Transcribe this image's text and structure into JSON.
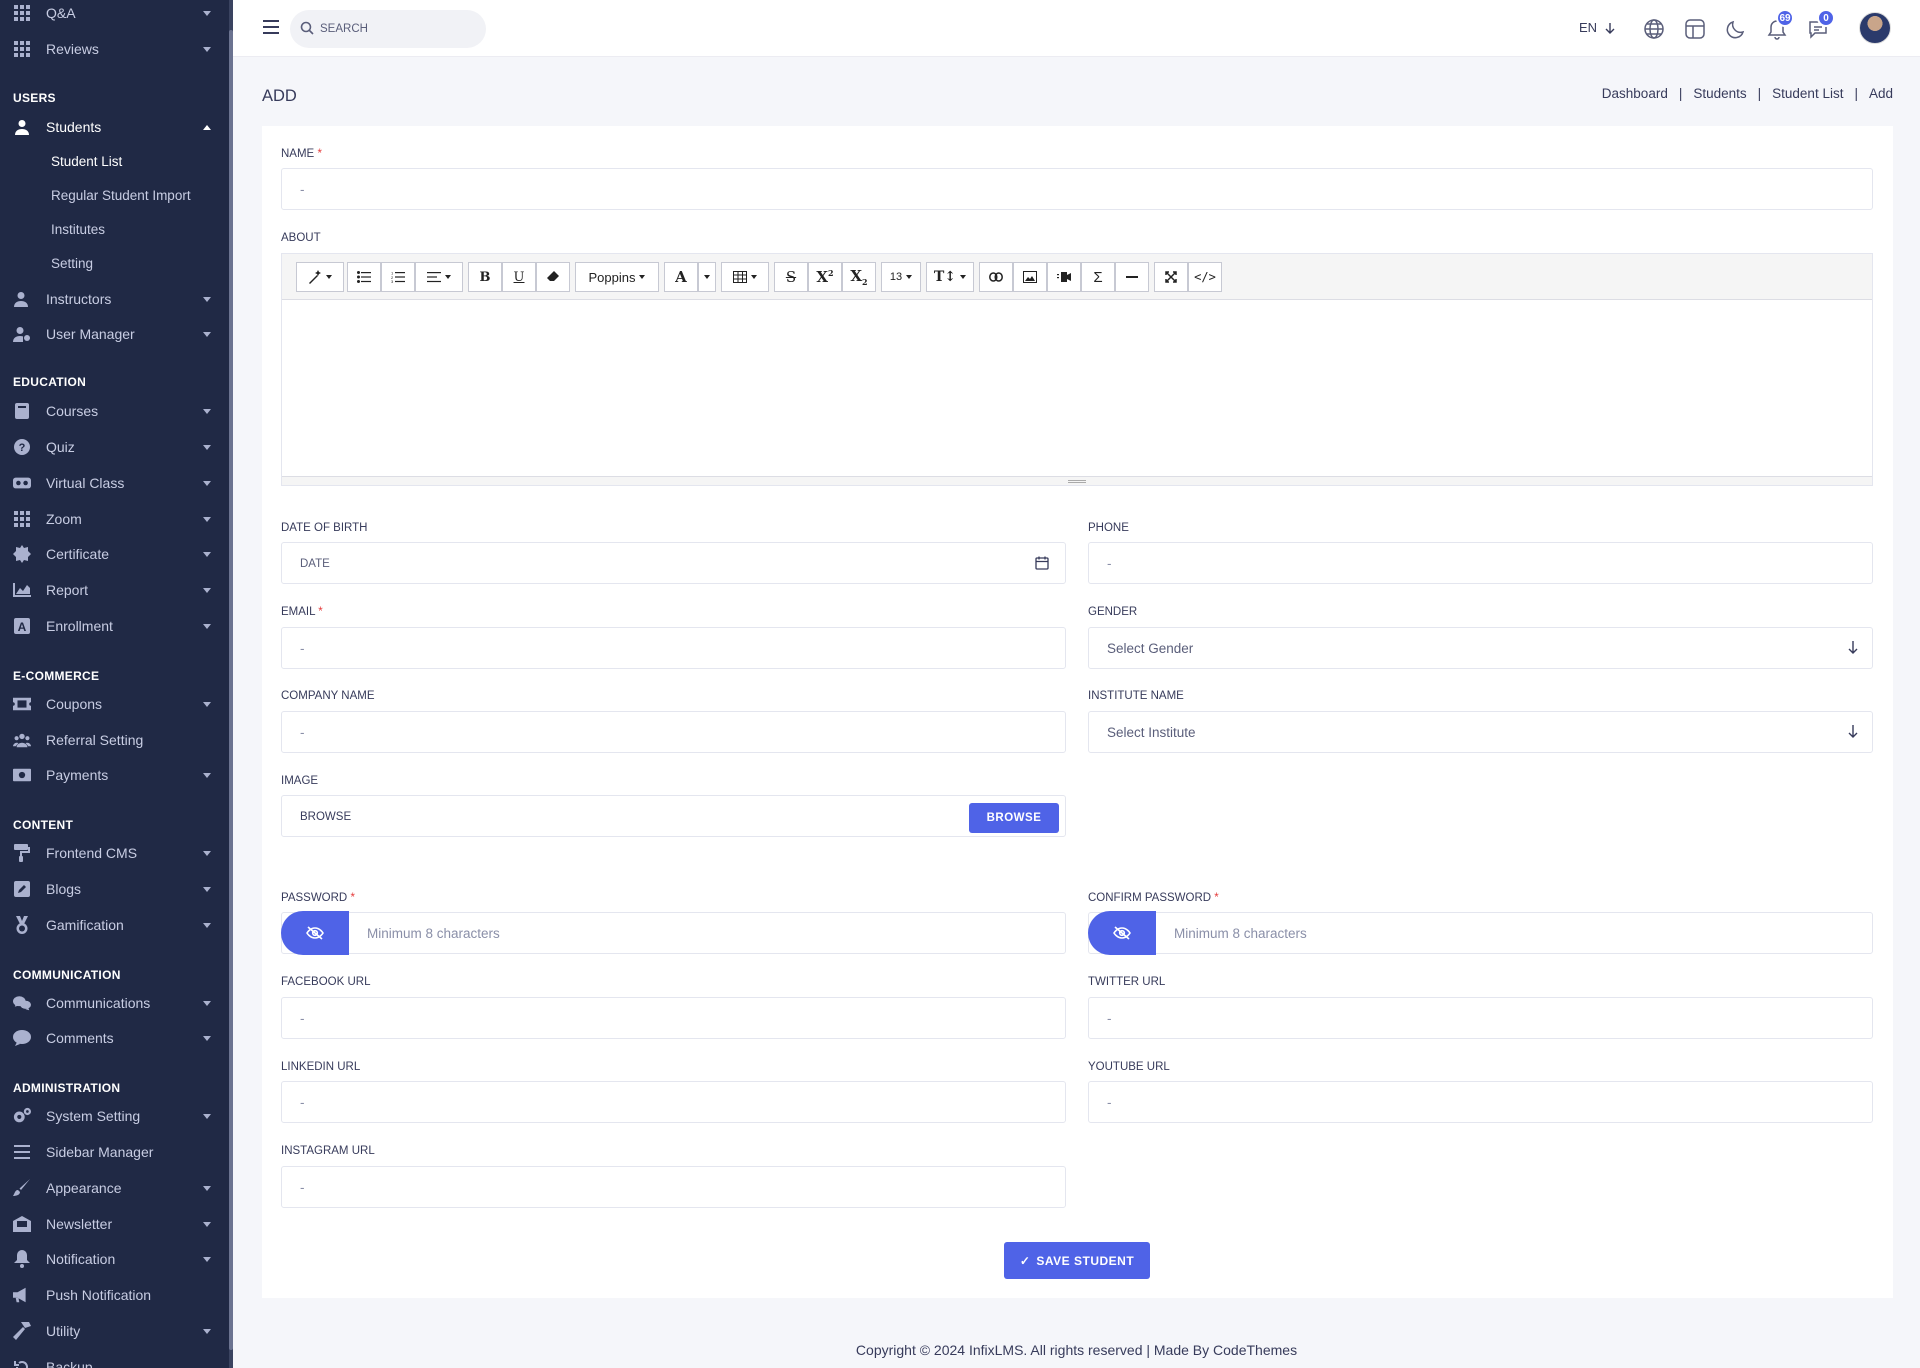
{
  "sidebar": {
    "items_top": [
      {
        "label": "Q&A",
        "icon": "grid-icon"
      },
      {
        "label": "Reviews",
        "icon": "grid-icon"
      }
    ],
    "sections": {
      "users": "USERS",
      "education": "EDUCATION",
      "ecommerce": "E-COMMERCE",
      "content": "CONTENT",
      "communication": "COMMUNICATION",
      "administration": "ADMINISTRATION"
    },
    "students": "Students",
    "student_sub": [
      "Student List",
      "Regular Student Import",
      "Institutes",
      "Setting"
    ],
    "users_items": [
      "Instructors",
      "User Manager"
    ],
    "education_items": [
      "Courses",
      "Quiz",
      "Virtual Class",
      "Zoom",
      "Certificate",
      "Report",
      "Enrollment"
    ],
    "ecommerce_items": [
      "Coupons",
      "Referral Setting",
      "Payments"
    ],
    "content_items": [
      "Frontend CMS",
      "Blogs",
      "Gamification"
    ],
    "communication_items": [
      "Communications",
      "Comments"
    ],
    "admin_items": [
      "System Setting",
      "Sidebar Manager",
      "Appearance",
      "Newsletter",
      "Notification",
      "Push Notification",
      "Utility",
      "Backup"
    ]
  },
  "topbar": {
    "search_placeholder": "SEARCH",
    "lang": "EN",
    "notif_count": "69",
    "msg_count": "0"
  },
  "page": {
    "title": "ADD",
    "breadcrumb": [
      "Dashboard",
      "Students",
      "Student List",
      "Add"
    ]
  },
  "form": {
    "name_label": "NAME",
    "name_ph": "-",
    "about_label": "ABOUT",
    "editor_font": "Poppins",
    "editor_size": "13",
    "dob_label": "DATE OF BIRTH",
    "dob_ph": "DATE",
    "phone_label": "PHONE",
    "phone_ph": "-",
    "email_label": "EMAIL",
    "email_ph": "-",
    "gender_label": "GENDER",
    "gender_value": "Select Gender",
    "company_label": "COMPANY NAME",
    "company_ph": "-",
    "institute_label": "INSTITUTE NAME",
    "institute_value": "Select Institute",
    "image_label": "IMAGE",
    "image_ph": "BROWSE",
    "browse_btn": "BROWSE",
    "password_label": "PASSWORD",
    "password_ph": "Minimum 8 characters",
    "confirm_label": "CONFIRM PASSWORD",
    "confirm_ph": "Minimum 8 characters",
    "facebook_label": "FACEBOOK URL",
    "facebook_ph": "-",
    "twitter_label": "TWITTER URL",
    "twitter_ph": "-",
    "linkedin_label": "LINKEDIN URL",
    "linkedin_ph": "-",
    "youtube_label": "YOUTUBE URL",
    "youtube_ph": "-",
    "instagram_label": "INSTAGRAM URL",
    "instagram_ph": "-",
    "save_btn": "SAVE STUDENT"
  },
  "footer": "Copyright © 2024 InfixLMS. All rights reserved | Made By CodeThemes",
  "colors": {
    "sidebar": "#202945",
    "accent": "#4f63e7",
    "required": "#e53b3b"
  }
}
